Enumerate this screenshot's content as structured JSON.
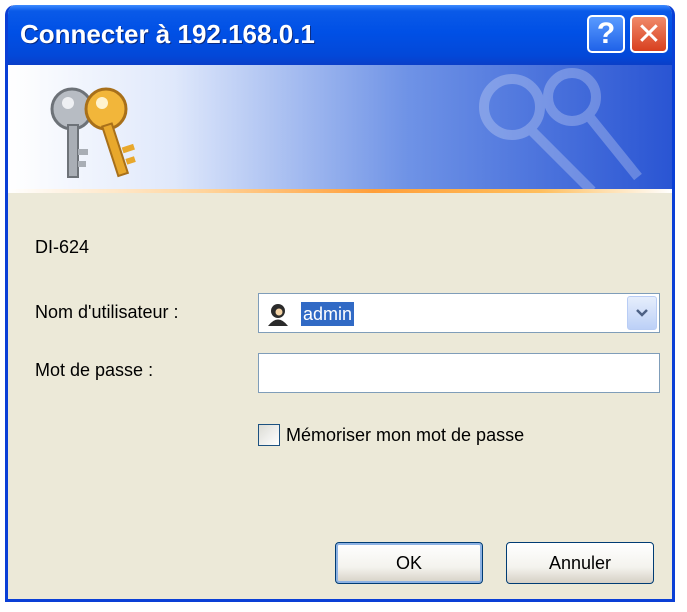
{
  "window": {
    "title": "Connecter à 192.168.0.1"
  },
  "titlebar": {
    "help_glyph": "?",
    "close_glyph": "✕"
  },
  "banner": {
    "icon": "keys-icon"
  },
  "server": {
    "name": "DI-624"
  },
  "form": {
    "username_label": "Nom d'utilisateur :",
    "username_value": "admin",
    "password_label": "Mot de passe :",
    "password_value": "",
    "remember_label": "Mémoriser mon mot de passe",
    "remember_checked": false
  },
  "buttons": {
    "ok": "OK",
    "cancel": "Annuler"
  },
  "colors": {
    "titlebar": "#0050e6",
    "window_bg": "#ece9d8",
    "selection": "#316ac5",
    "close": "#d8401f"
  }
}
